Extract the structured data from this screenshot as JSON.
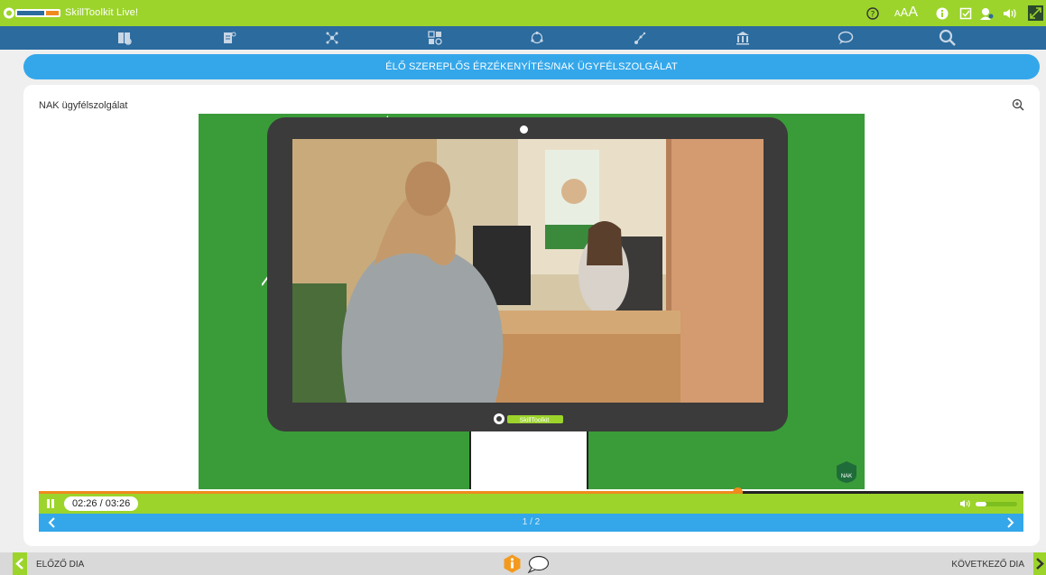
{
  "app": {
    "title": "SkillToolkit Live!",
    "logo_text": "SKILLTOOLKIT"
  },
  "topbar": {
    "font_size_label": "AAA",
    "icons": [
      "help-icon",
      "font-size-icon",
      "info-icon",
      "checkbox-icon",
      "user-icon",
      "sound-icon",
      "fullscreen-icon"
    ]
  },
  "navbar": {
    "icons": [
      "book-icon",
      "document-icon",
      "molecule-icon",
      "grid-icon",
      "cycle-icon",
      "graph-icon",
      "building-icon",
      "chat-icon",
      "search-icon"
    ]
  },
  "banner": {
    "title": "ÉLŐ SZEREPLŐS ÉRZÉKENYÍTÉS/NAK ÜGYFÉLSZOLGÁLAT"
  },
  "card": {
    "title": "NAK ügyfélszolgálat"
  },
  "video": {
    "brand": "SkillToolkit",
    "corner_logo": "NAK",
    "progress": 0.709,
    "time": "02:26 / 03:26",
    "volume": 0.25
  },
  "pager": {
    "text": "1 / 2"
  },
  "footer": {
    "prev_label": "ELŐZŐ DIA",
    "next_label": "KÖVETKEZŐ DIA"
  },
  "colors": {
    "green": "#9cd42b",
    "nav_blue": "#2b6b9e",
    "banner_blue": "#34a7ea",
    "video_green": "#3a9c38",
    "progress_orange": "#f08a1d",
    "info_orange": "#f39a1e"
  }
}
